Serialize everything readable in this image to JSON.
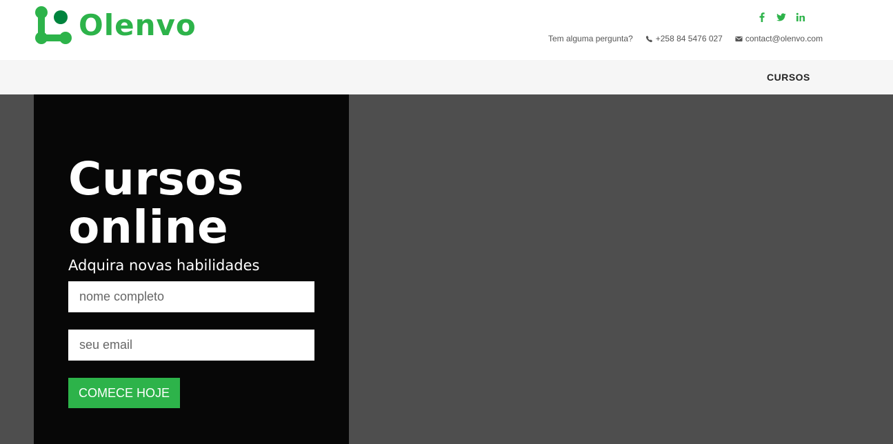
{
  "header": {
    "brand": "Olenvo",
    "social_icons": [
      "facebook-icon",
      "twitter-icon",
      "linkedin-icon"
    ],
    "contact_question": "Tem alguma pergunta?",
    "phone": "+258 84 5476 027",
    "email": "contact@olenvo.com"
  },
  "nav": {
    "items": [
      {
        "label": "CURSOS"
      }
    ]
  },
  "hero": {
    "title_line_1": "Cursos",
    "title_line_2": "online",
    "subtitle": "Adquira novas habilidades",
    "name_placeholder": "nome completo",
    "email_placeholder": "seu email",
    "cta_label": "COMECE HOJE"
  },
  "colors": {
    "accent": "#2db34a",
    "hero_panel": "#070707",
    "hero_background": "#4e4e4e",
    "nav_background": "#f6f6f6"
  }
}
